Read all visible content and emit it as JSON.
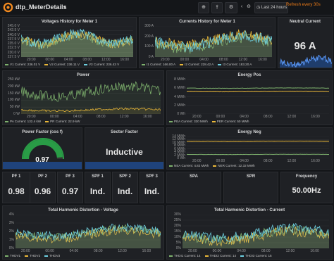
{
  "header": {
    "title": "dtp_MeterDetails",
    "time_range": "Last 24 hours",
    "refresh": "Refresh every 30s"
  },
  "colors": {
    "green": "#7eb26d",
    "yellow": "#eab839",
    "blue": "#6ed0e0",
    "orange": "#ef843c",
    "gauge_green": "#299c46"
  },
  "panels": {
    "voltages": {
      "title": "Voltages History for Meter 1",
      "yticks": [
        "245.0 V",
        "242.5 V",
        "240.0 V",
        "237.5 V",
        "235.0 V",
        "232.5 V",
        "230.0 V",
        "227.5 V"
      ],
      "xticks": [
        "20:00",
        "00:00",
        "04:00",
        "08:00",
        "12:00",
        "16:00"
      ],
      "legend": [
        {
          "label": "V1  Current: 236.01 V",
          "color": "#7eb26d"
        },
        {
          "label": "V2  Current: 236.11 V",
          "color": "#eab839"
        },
        {
          "label": "V3  Current: 236.43 V",
          "color": "#6ed0e0"
        }
      ]
    },
    "currents": {
      "title": "Currents History for Meter 1",
      "yticks": [
        "300 A",
        "200 A",
        "100 A",
        "0 A"
      ],
      "xticks": [
        "20:00",
        "00:00",
        "04:00",
        "08:00",
        "12:00",
        "16:00"
      ],
      "legend": [
        {
          "label": "I1  Current: 166.00 A",
          "color": "#7eb26d"
        },
        {
          "label": "I2  Current: 228.42 A",
          "color": "#eab839"
        },
        {
          "label": "I3  Current: 183.20 A",
          "color": "#6ed0e0"
        }
      ]
    },
    "neutral": {
      "title": "Neutral Current",
      "value": "96 A"
    },
    "power": {
      "title": "Power",
      "yticks": [
        "250 kW",
        "200 kW",
        "150 kW",
        "100 kW",
        "50 kW",
        "0 W"
      ],
      "xticks": [
        "20:00",
        "00:00",
        "04:00",
        "08:00",
        "12:00",
        "16:00"
      ],
      "legend": [
        {
          "label": "PA  Current: 132.4 kW",
          "color": "#7eb26d"
        },
        {
          "label": "PR  Current: 22.9 kW",
          "color": "#eab839"
        }
      ]
    },
    "energy_pos": {
      "title": "Energy Pos",
      "yticks": [
        "8 MWh",
        "6 MWh",
        "4 MWh",
        "2 MWh",
        "0 Wh"
      ],
      "xticks": [
        "20:00",
        "00:00",
        "04:00",
        "08:00",
        "12:00",
        "16:00"
      ],
      "legend": [
        {
          "label": "PEA  Current: 330 MWh",
          "color": "#7eb26d"
        },
        {
          "label": "PER  Current: 50 MWh",
          "color": "#eab839"
        }
      ]
    },
    "pf_gauge": {
      "title": "Power Factor (cos f)",
      "value": "0.97",
      "fraction": 0.97
    },
    "sector": {
      "title": "Sector Factor",
      "value": "Inductive"
    },
    "energy_neg": {
      "title": "Energy Neg",
      "yticks": [
        "14 MWh",
        "12 MWh",
        "10 MWh",
        "8 MWh",
        "6 MWh",
        "4 MWh",
        "2 MWh",
        "0 Wh"
      ],
      "xticks": [
        "20:00",
        "00:00",
        "04:00",
        "08:00",
        "12:00",
        "16:00"
      ],
      "legend": [
        {
          "label": "NEA  Current: 4.82 MWh",
          "color": "#7eb26d"
        },
        {
          "label": "NER  Current: 12.32 MWh",
          "color": "#eab839"
        }
      ]
    },
    "stats": [
      {
        "title": "PF 1",
        "value": "0.98"
      },
      {
        "title": "PF 2",
        "value": "0.96"
      },
      {
        "title": "PF 3",
        "value": "0.97"
      },
      {
        "title": "SPF 1",
        "value": "Ind."
      },
      {
        "title": "SPF 2",
        "value": "Ind."
      },
      {
        "title": "SPF 3",
        "value": "Ind."
      },
      {
        "title": "SPA",
        "value": ""
      },
      {
        "title": "SPR",
        "value": ""
      },
      {
        "title": "Frequency",
        "value": "50.00Hz"
      }
    ],
    "thd_v": {
      "title": "Total Harmonic Distortion - Voltage",
      "yticks": [
        "4%",
        "3%",
        "2%",
        "1%",
        "0%"
      ],
      "xticks": [
        "20:00",
        "00:00",
        "04:00",
        "08:00",
        "12:00",
        "16:00"
      ],
      "legend": [
        {
          "label": "THDV1",
          "color": "#7eb26d"
        },
        {
          "label": "THDV2",
          "color": "#eab839"
        },
        {
          "label": "THDV3",
          "color": "#6ed0e0"
        }
      ]
    },
    "thd_i": {
      "title": "Total Harmonic Distortion - Current",
      "yticks": [
        "30%",
        "25%",
        "20%",
        "15%",
        "10%",
        "5%",
        "0%"
      ],
      "xticks": [
        "20:00",
        "00:00",
        "04:00",
        "08:00",
        "12:00",
        "16:00"
      ],
      "legend": [
        {
          "label": "THDI1  Current: 14",
          "color": "#7eb26d"
        },
        {
          "label": "THDI2  Current: 14",
          "color": "#eab839"
        },
        {
          "label": "THDI3  Current: 15",
          "color": "#6ed0e0"
        }
      ]
    }
  }
}
